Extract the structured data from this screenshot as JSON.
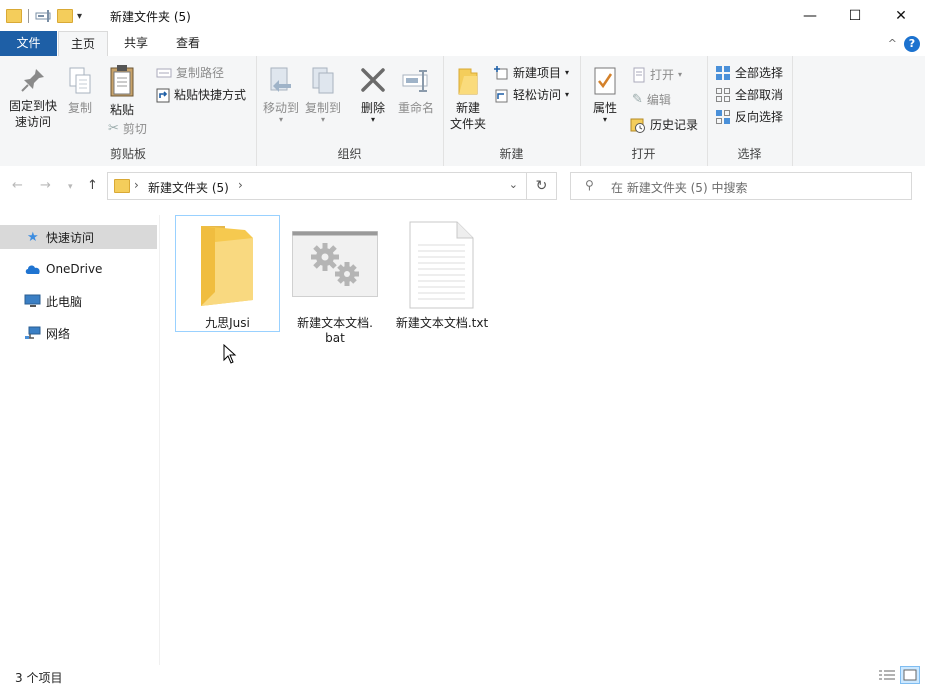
{
  "window": {
    "title": "新建文件夹 (5)",
    "minimize_glyph": "—",
    "maximize_glyph": "☐",
    "close_glyph": "✕"
  },
  "tabs": {
    "file": "文件",
    "home": "主页",
    "share": "共享",
    "view": "查看",
    "help_glyph": "?",
    "collapse_glyph": "^"
  },
  "ribbon": {
    "clipboard": {
      "label": "剪贴板",
      "pin": "固定到快速访问",
      "pin_line1": "固定到快",
      "pin_line2": "速访问",
      "copy": "复制",
      "paste": "粘贴",
      "copy_path": "复制路径",
      "paste_shortcut": "粘贴快捷方式",
      "cut": "剪切"
    },
    "organize": {
      "label": "组织",
      "move_to": "移动到",
      "copy_to": "复制到",
      "delete": "删除",
      "rename": "重命名"
    },
    "new": {
      "label": "新建",
      "new_folder_line1": "新建",
      "new_folder_line2": "文件夹",
      "new_item": "新建项目",
      "easy_access": "轻松访问"
    },
    "open": {
      "label": "打开",
      "properties": "属性",
      "open": "打开",
      "edit": "编辑",
      "history": "历史记录"
    },
    "select": {
      "label": "选择",
      "select_all": "全部选择",
      "select_none": "全部取消",
      "invert": "反向选择"
    }
  },
  "address": {
    "path": "新建文件夹 (5)",
    "search_placeholder": "在 新建文件夹 (5) 中搜索"
  },
  "nav": {
    "items": [
      {
        "label": "快速访问",
        "icon": "star-icon"
      },
      {
        "label": "OneDrive",
        "icon": "cloud-icon"
      },
      {
        "label": "此电脑",
        "icon": "computer-icon"
      },
      {
        "label": "网络",
        "icon": "network-icon"
      }
    ]
  },
  "files": [
    {
      "name": "九思Jusi",
      "type": "folder"
    },
    {
      "name_line1": "新建文本文档.",
      "name_line2": "bat",
      "type": "bat"
    },
    {
      "name": "新建文本文档.txt",
      "type": "txt"
    }
  ],
  "status": {
    "count": "3 个项目"
  },
  "colors": {
    "accent": "#1e5fa6",
    "folder": "#f4cd5b",
    "selection": "#99d1ff"
  }
}
